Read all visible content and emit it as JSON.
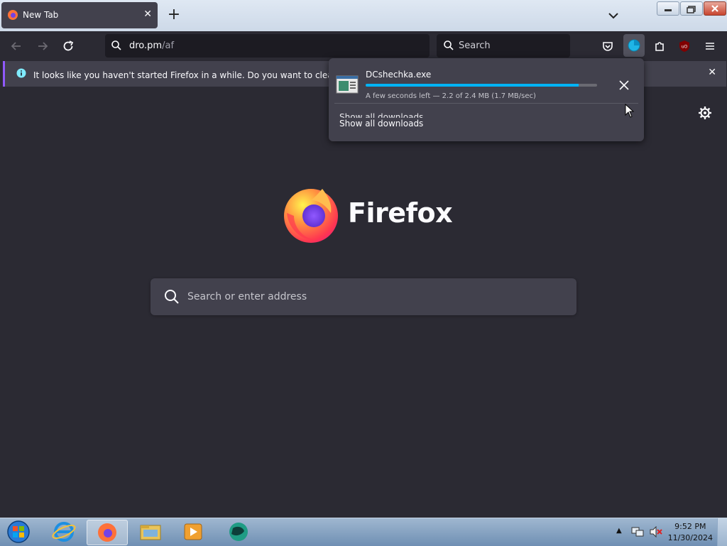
{
  "tab": {
    "title": "New Tab",
    "close_icon": "close-icon"
  },
  "toolbar": {
    "url_host": "dro.pm",
    "url_path": "/af",
    "search_placeholder": "Search"
  },
  "notification": {
    "message": "It looks like you haven't started Firefox in a while. Do you want to clean it up for"
  },
  "downloads_panel": {
    "filename": "DCshechka.exe",
    "status": "A few seconds left — 2.2 of 2.4 MB (1.7 MB/sec)",
    "progress_fraction": 0.92,
    "show_all": "Show all downloads"
  },
  "content": {
    "brand": "Firefox",
    "search_placeholder": "Search or enter address"
  },
  "taskbar": {
    "time": "9:52 PM",
    "date": "11/30/2024"
  },
  "colors": {
    "accent": "#00b3f4",
    "background": "#2b2a33",
    "panel": "#42414d"
  }
}
